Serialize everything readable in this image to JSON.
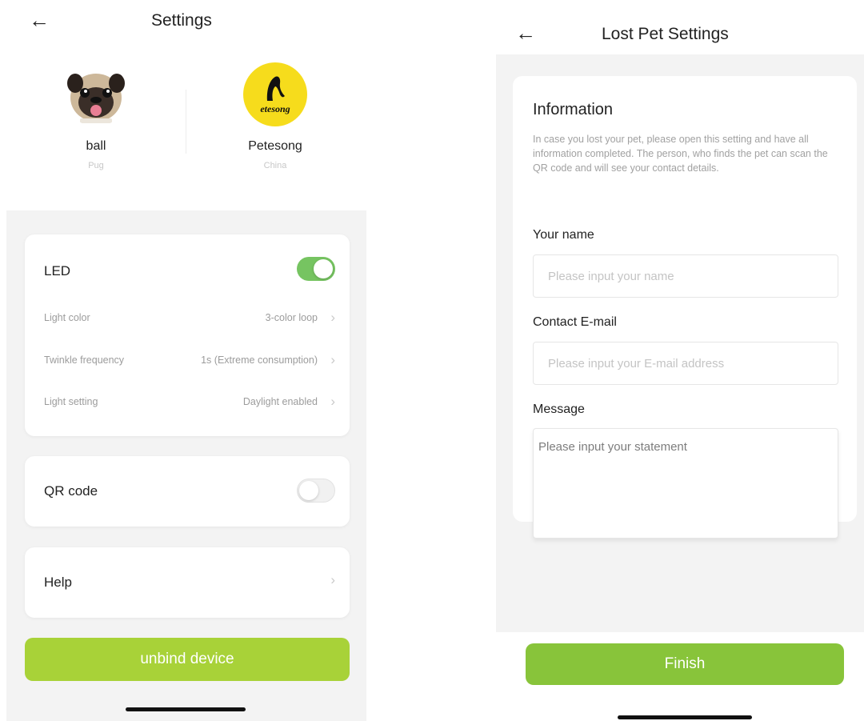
{
  "left": {
    "header": {
      "back_icon": "arrow-left-icon",
      "title": "Settings"
    },
    "pets": [
      {
        "name": "ball",
        "breed": "Pug",
        "avatar": "pug-photo"
      },
      {
        "name": "Petesong",
        "breed": "China",
        "avatar": "petesong-logo",
        "logo_text": "etesong"
      }
    ],
    "led": {
      "label": "LED",
      "enabled": true,
      "rows": [
        {
          "label": "Light color",
          "value": "3-color loop"
        },
        {
          "label": "Twinkle frequency",
          "value": "1s (Extreme consumption)"
        },
        {
          "label": "Light setting",
          "value": "Daylight enabled"
        }
      ]
    },
    "qr": {
      "label": "QR code",
      "enabled": false
    },
    "help": {
      "label": "Help"
    },
    "unbind_label": "unbind device"
  },
  "right": {
    "header": {
      "back_icon": "arrow-left-icon",
      "title": "Lost Pet Settings"
    },
    "info": {
      "title": "Information",
      "description": "In case you lost your pet, please open this setting and have all information completed.  The person, who finds the pet can scan the QR code and will see your contact details."
    },
    "name": {
      "label": "Your name",
      "value": "",
      "placeholder": "Please input your name"
    },
    "email": {
      "label": "Contact E-mail",
      "value": "",
      "placeholder": "Please input your E-mail address"
    },
    "message": {
      "label": "Message",
      "value": "",
      "placeholder": "Please input your statement"
    },
    "finish_label": "Finish"
  },
  "colors": {
    "toggle_on": "#76c461",
    "unbind_button": "#a8d238",
    "finish_button": "#88c43a",
    "avatar_yellow": "#f6dc1c",
    "panel_bg": "#f3f3f3"
  }
}
